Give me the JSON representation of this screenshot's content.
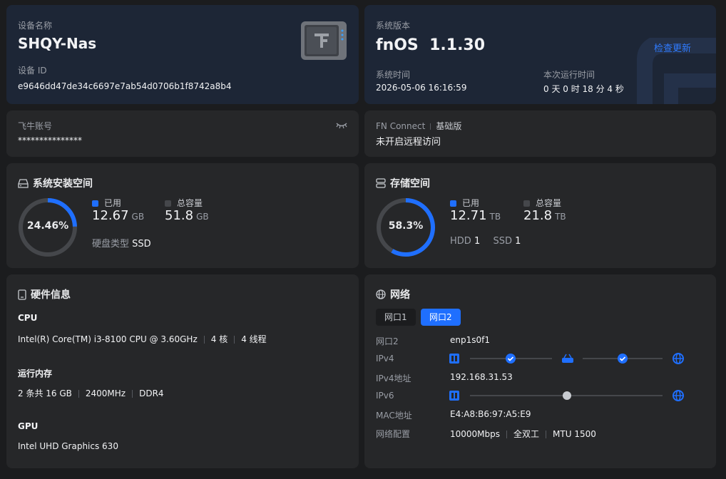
{
  "device": {
    "name_label": "设备名称",
    "name": "SHQY-Nas",
    "id_label": "设备 ID",
    "id": "e9646dd47de34c6697e7ab54d0706b1f8742a8b4"
  },
  "system": {
    "version_label": "系统版本",
    "version": "fnOS  1.1.30",
    "check_update": "检查更新",
    "time_label": "系统时间",
    "time": "2026-05-06 16:16:59",
    "uptime_label": "本次运行时间",
    "uptime": "0 天 0 时 18 分 4 秒"
  },
  "account": {
    "label": "飞牛账号",
    "value": "***************"
  },
  "fnconnect": {
    "label": "FN Connect",
    "edition": "基础版",
    "status": "未开启远程访问"
  },
  "sys_storage": {
    "title": "系统安装空间",
    "percent_text": "24.46%",
    "percent": 24.46,
    "used_label": "已用",
    "used_value": "12.67",
    "used_unit": "GB",
    "total_label": "总容量",
    "total_value": "51.8",
    "total_unit": "GB",
    "disk_type_label": "硬盘类型",
    "disk_type": "SSD"
  },
  "storage": {
    "title": "存储空间",
    "percent_text": "58.3%",
    "percent": 58.3,
    "used_label": "已用",
    "used_value": "12.71",
    "used_unit": "TB",
    "total_label": "总容量",
    "total_value": "21.8",
    "total_unit": "TB",
    "hdd_label": "HDD",
    "hdd_count": "1",
    "ssd_label": "SSD",
    "ssd_count": "1"
  },
  "hardware": {
    "title": "硬件信息",
    "cpu_label": "CPU",
    "cpu_model": "Intel(R) Core(TM) i3-8100 CPU @ 3.60GHz",
    "cpu_cores": "4 核",
    "cpu_threads": "4 线程",
    "mem_label": "运行内存",
    "mem_size": "2 条共 16 GB",
    "mem_speed": "2400MHz",
    "mem_type": "DDR4",
    "gpu_label": "GPU",
    "gpu_model": "Intel UHD Graphics 630"
  },
  "network": {
    "title": "网络",
    "tabs": [
      "网口1",
      "网口2"
    ],
    "active_tab": 1,
    "port_label": "网口2",
    "port_value": "enp1s0f1",
    "ipv4_label": "IPv4",
    "ipv4_addr_label": "IPv4地址",
    "ipv4_addr": "192.168.31.53",
    "ipv6_label": "IPv6",
    "mac_label": "MAC地址",
    "mac": "E4:A8:B6:97:A5:E9",
    "config_label": "网络配置",
    "speed": "10000Mbps",
    "duplex": "全双工",
    "mtu": "MTU 1500"
  },
  "colors": {
    "accent": "#1f6fff",
    "ring_bg": "#45474b",
    "card": "#262729",
    "card_blue": "#1d2636"
  }
}
